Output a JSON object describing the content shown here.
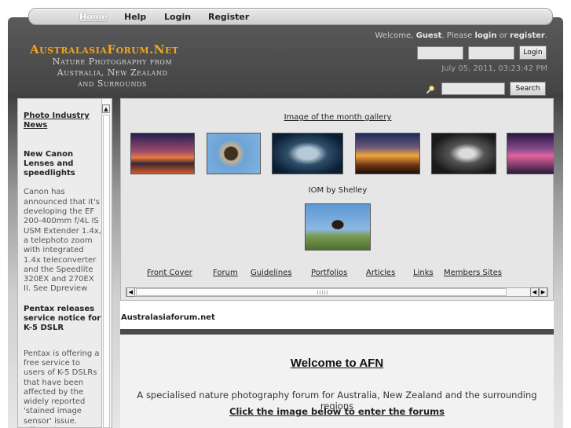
{
  "nav": {
    "home": "Home",
    "help": "Help",
    "login": "Login",
    "register": "Register"
  },
  "header": {
    "logo_title": "AustralasiaForum.Net",
    "logo_sub": [
      "Nature Photography from",
      "Australia, New Zealand",
      "and Surrounds"
    ],
    "welcome_prefix": "Welcome, ",
    "welcome_guest": "Guest",
    "welcome_mid1": ". Please ",
    "welcome_login": "login",
    "welcome_mid2": " or ",
    "welcome_register": "register",
    "welcome_suffix": ".",
    "login_button": "Login",
    "datetime": "July 05, 2011, 03:23:42 PM",
    "search_button": "Search"
  },
  "sidebar": {
    "heading": "Photo Industry News",
    "items": [
      {
        "title": "New Canon Lenses and speedlights",
        "body": "Canon has announced that it's developing the EF 200-400mm f/4L IS USM Extender 1.4x, a telephoto zoom with integrated 1.4x teleconverter and the Speedlite 320EX and 270EX II. See Dpreview"
      },
      {
        "title": "Pentax releases service notice for K-5 DSLR",
        "body": "Pentax is offering a free service to users of K-5 DSLRs that have been affected by the widely reported 'stained image sensor' issue. Affected camera"
      }
    ]
  },
  "gallery": {
    "link": "Image of the month gallery",
    "iom_label": "IOM by Shelley"
  },
  "menu": [
    "Front Cover",
    "Forum",
    "Guidelines",
    "Portfolios",
    "Articles",
    "Links",
    "Members Sites"
  ],
  "content": {
    "site_label": "Australasiaforum.net",
    "welcome_heading": "Welcome to AFN",
    "tagline": "A specialised nature photography forum for Australia, New Zealand and the surrounding regions",
    "enter_link": "Click the image below to enter the forums"
  }
}
